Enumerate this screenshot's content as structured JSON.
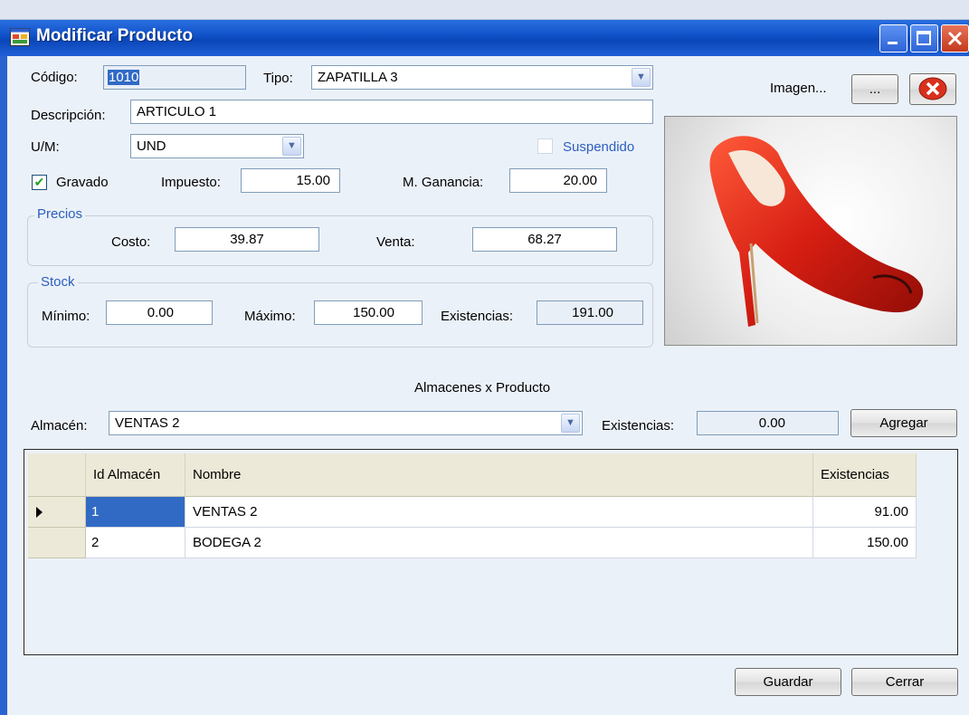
{
  "window": {
    "title": "Modificar Producto"
  },
  "form": {
    "codigo_label": "Código:",
    "codigo_value": "1010",
    "tipo_label": "Tipo:",
    "tipo_value": "ZAPATILLA 3",
    "imagen_label": "Imagen...",
    "browse_label": "...",
    "descripcion_label": "Descripción:",
    "descripcion_value": "ARTICULO 1",
    "um_label": "U/M:",
    "um_value": "UND",
    "suspendido_label": "Suspendido",
    "gravado_label": "Gravado",
    "gravado_checked": true,
    "impuesto_label": "Impuesto:",
    "impuesto_value": "15.00",
    "ganancia_label": "M. Ganancia:",
    "ganancia_value": "20.00"
  },
  "precios": {
    "title": "Precios",
    "costo_label": "Costo:",
    "costo_value": "39.87",
    "venta_label": "Venta:",
    "venta_value": "68.27"
  },
  "stock": {
    "title": "Stock",
    "minimo_label": "Mínimo:",
    "minimo_value": "0.00",
    "maximo_label": "Máximo:",
    "maximo_value": "150.00",
    "existencias_label": "Existencias:",
    "existencias_value": "191.00"
  },
  "almacenes": {
    "section_title": "Almacenes x Producto",
    "almacen_label": "Almacén:",
    "almacen_value": "VENTAS 2",
    "existencias_label": "Existencias:",
    "existencias_value": "0.00",
    "agregar_label": "Agregar"
  },
  "grid": {
    "columns": [
      "Id Almacén",
      "Nombre",
      "Existencias"
    ],
    "rows": [
      [
        "1",
        "VENTAS 2",
        "91.00"
      ],
      [
        "2",
        "BODEGA 2",
        "150.00"
      ]
    ]
  },
  "actions": {
    "guardar_label": "Guardar",
    "cerrar_label": "Cerrar"
  },
  "colors": {
    "titlebar": "#1050c8",
    "client_bg": "#ebf1f8",
    "group_title": "#2b5fbf",
    "selection": "#316ac5"
  },
  "icons": {
    "app": "window-form-icon",
    "remove_image": "red-x-circle-icon",
    "row_pointer": "triangle-right-icon"
  }
}
